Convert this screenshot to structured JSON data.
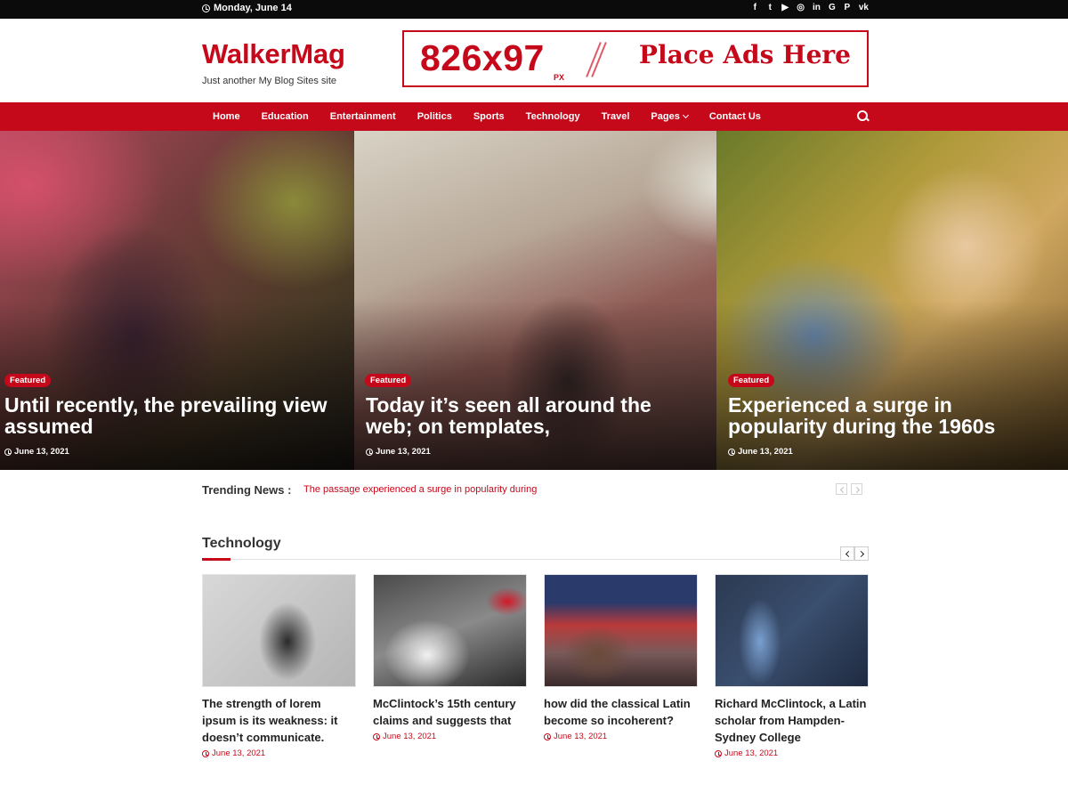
{
  "topbar": {
    "date": "Monday, June 14",
    "social_icons": [
      "facebook-icon",
      "twitter-icon",
      "youtube-icon",
      "instagram-icon",
      "linkedin-icon",
      "google-plus-icon",
      "pinterest-icon",
      "vk-icon"
    ],
    "social_glyphs": [
      "f",
      "t",
      "▶",
      "◎",
      "in",
      "G",
      "P",
      "vk"
    ]
  },
  "header": {
    "logo": "WalkerMag",
    "tagline": "Just another My Blog Sites site",
    "ad": {
      "size": "826x97",
      "unit": "PX",
      "text": "Place Ads Here"
    }
  },
  "nav": {
    "items": [
      "Home",
      "Education",
      "Entertainment",
      "Politics",
      "Sports",
      "Technology",
      "Travel",
      "Pages",
      "Contact Us"
    ]
  },
  "hero": [
    {
      "badge": "Featured",
      "title": "Until recently, the prevailing view assumed",
      "date": "June 13, 2021"
    },
    {
      "badge": "Featured",
      "title": "Today it’s seen all around the web; on templates,",
      "date": "June 13, 2021"
    },
    {
      "badge": "Featured",
      "title": "Experienced a surge in popularity during the 1960s",
      "date": "June 13, 2021"
    }
  ],
  "trending": {
    "label": "Trending News :",
    "headline": "The passage experienced a surge in popularity during"
  },
  "technology": {
    "title": "Technology",
    "posts": [
      {
        "title": "The strength of lorem ipsum is its weakness: it doesn’t communicate.",
        "date": "June 13, 2021"
      },
      {
        "title": "McClintock’s 15th century claims and suggests that",
        "date": "June 13, 2021"
      },
      {
        "title": "how did the classical Latin become so incoherent?",
        "date": "June 13, 2021"
      },
      {
        "title": "Richard McClintock, a Latin scholar from Hampden-Sydney College",
        "date": "June 13, 2021"
      }
    ]
  },
  "colors": {
    "accent": "#c5091b",
    "topbar": "#0b0b0b"
  }
}
